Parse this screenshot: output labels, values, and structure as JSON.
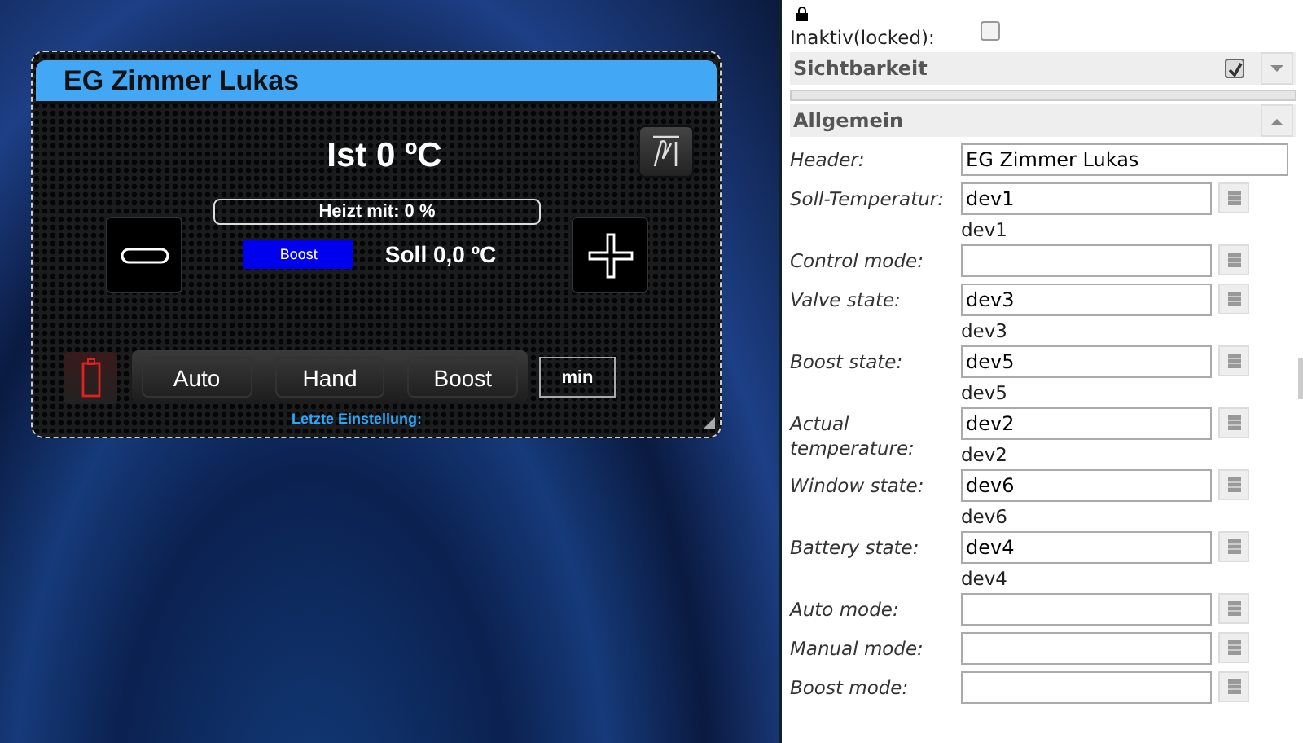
{
  "widget": {
    "title": "EG Zimmer Lukas",
    "actual": "Ist 0 ºC",
    "heating": "Heizt mit: 0 %",
    "boost_badge": "Boost",
    "setpoint": "Soll 0,0 ºC",
    "modes": [
      "Auto",
      "Hand",
      "Boost"
    ],
    "minutes": "min",
    "last_setting": "Letzte Einstellung:"
  },
  "panel": {
    "locked": {
      "label": "Inaktiv(locked):",
      "checked": false
    },
    "sections": [
      {
        "kind": "checkable",
        "title": "Sichtbarkeit",
        "checked": true,
        "expanded": false
      },
      {
        "kind": "plain",
        "title": "Allgemein",
        "expanded": true
      }
    ],
    "fields": [
      {
        "kind": "text",
        "label": "Header:",
        "value": "EG Zimmer Lukas"
      },
      {
        "kind": "binding",
        "label": "Soll-Temperatur:",
        "value": "dev1",
        "note": "dev1"
      },
      {
        "kind": "binding",
        "label": "Control mode:"
      },
      {
        "kind": "binding",
        "label": "Valve state:",
        "value": "dev3",
        "note": "dev3"
      },
      {
        "kind": "binding",
        "label": "Boost state:",
        "value": "dev5",
        "note": "dev5"
      },
      {
        "kind": "binding",
        "label": "Actual temperature:",
        "value": "dev2",
        "note": "dev2"
      },
      {
        "kind": "binding",
        "label": "Window state:",
        "value": "dev6",
        "note": "dev6"
      },
      {
        "kind": "binding",
        "label": "Battery state:",
        "value": "dev4",
        "note": "dev4"
      },
      {
        "kind": "binding",
        "label": "Auto mode:"
      },
      {
        "kind": "binding",
        "label": "Manual mode:"
      },
      {
        "kind": "binding",
        "label": "Boost mode:"
      }
    ]
  }
}
